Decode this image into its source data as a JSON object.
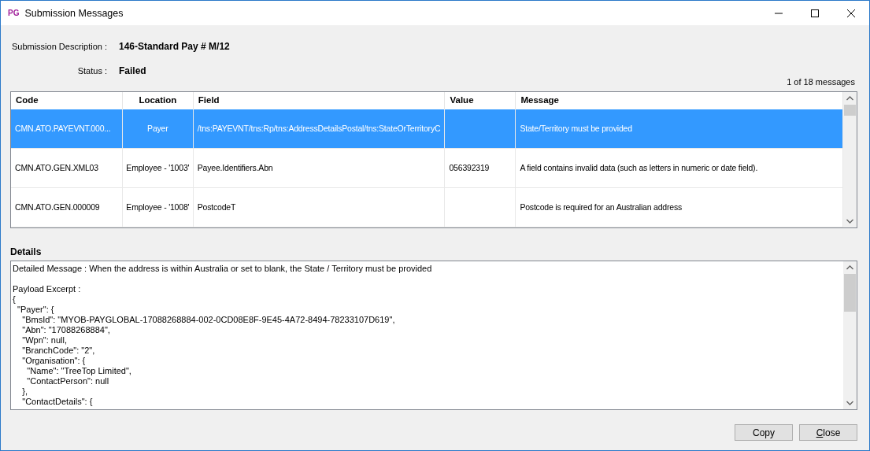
{
  "window": {
    "app_icon": "PG",
    "title": "Submission Messages"
  },
  "summary": [
    {
      "label": "Submission Description :",
      "value": "146-Standard Pay # M/12"
    },
    {
      "label": "Status :",
      "value": "Failed"
    }
  ],
  "message_count": "1 of 18 messages",
  "table": {
    "columns": [
      "Code",
      "Location",
      "Field",
      "Value",
      "Message"
    ],
    "rows": [
      {
        "selected": true,
        "cells": [
          "CMN.ATO.PAYEVNT.000...",
          "Payer",
          "/tns:PAYEVNT/tns:Rp/tns:AddressDetailsPostal/tns:StateOrTerritoryC",
          "",
          "State/Territory must be provided"
        ]
      },
      {
        "selected": false,
        "cells": [
          "CMN.ATO.GEN.XML03",
          "Employee - '1003'",
          "Payee.Identifiers.Abn",
          "056392319",
          "A field contains invalid data (such as letters in numeric or date field)."
        ]
      },
      {
        "selected": false,
        "cells": [
          "CMN.ATO.GEN.000009",
          "Employee - '1008'",
          "PostcodeT",
          "",
          "Postcode is required for an Australian address"
        ]
      }
    ]
  },
  "details": {
    "label": "Details",
    "text": "Detailed Message : When the address is within Australia or set to blank, the State / Territory must be provided\n\nPayload Excerpt :\n{\n  \"Payer\": {\n    \"BmsId\": \"MYOB-PAYGLOBAL-17088268884-002-0CD08E8F-9E45-4A72-8494-78233107D619\",\n    \"Abn\": \"17088268884\",\n    \"Wpn\": null,\n    \"BranchCode\": \"2\",\n    \"Organisation\": {\n      \"Name\": \"TreeTop Limited\",\n      \"ContactPerson\": null\n    },\n    \"ContactDetails\": {"
  },
  "buttons": [
    "Copy",
    "Close"
  ]
}
